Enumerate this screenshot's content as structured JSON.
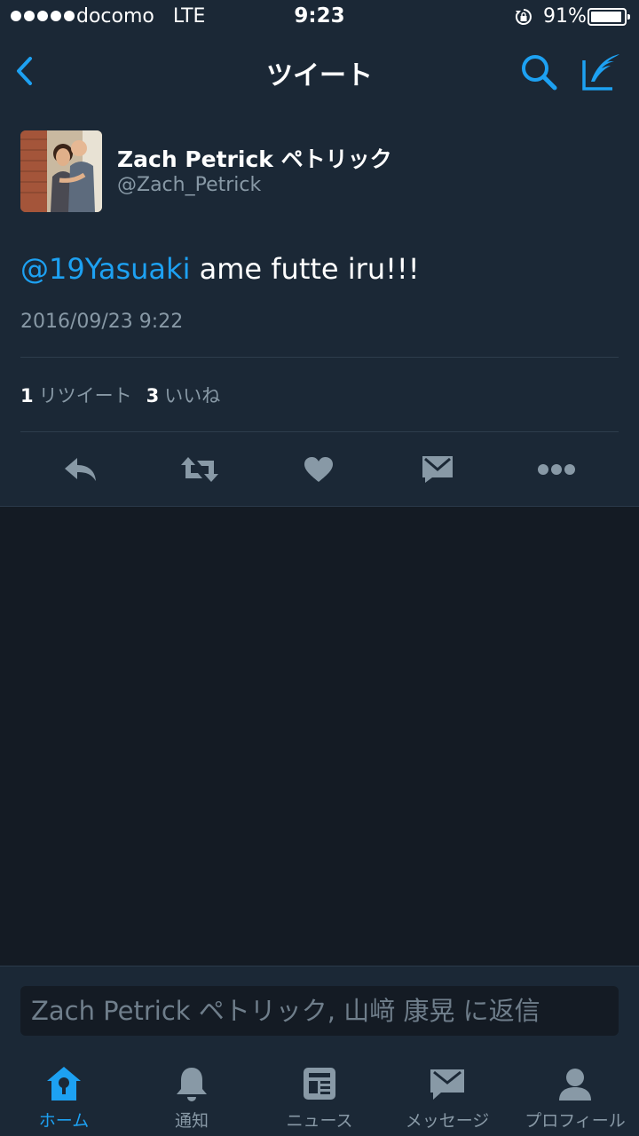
{
  "status_bar": {
    "carrier": "docomo",
    "network": "LTE",
    "time": "9:23",
    "battery_percent": "91%",
    "battery_level": 0.91
  },
  "header": {
    "title": "ツイート"
  },
  "tweet": {
    "author_name": "Zach Petrick ペトリック",
    "author_handle": "@Zach_Petrick",
    "mention": "@19Yasuaki",
    "text": " ame futte iru!!!",
    "timestamp": "2016/09/23 9:22",
    "retweet_count": "1",
    "retweet_label": "リツイート",
    "like_count": "3",
    "like_label": "いいね"
  },
  "reply": {
    "placeholder": "Zach Petrick ペトリック, 山﨑 康晃 に返信"
  },
  "tabs": [
    {
      "label": "ホーム",
      "icon": "home-icon",
      "active": true
    },
    {
      "label": "通知",
      "icon": "bell-icon",
      "active": false
    },
    {
      "label": "ニュース",
      "icon": "news-icon",
      "active": false
    },
    {
      "label": "メッセージ",
      "icon": "message-icon",
      "active": false
    },
    {
      "label": "プロフィール",
      "icon": "profile-icon",
      "active": false
    }
  ],
  "colors": {
    "accent": "#1da1f2",
    "header_bg": "#1b2836",
    "page_bg": "#141b24",
    "muted_text": "#8899a6",
    "icon_gray": "#8899a6"
  }
}
